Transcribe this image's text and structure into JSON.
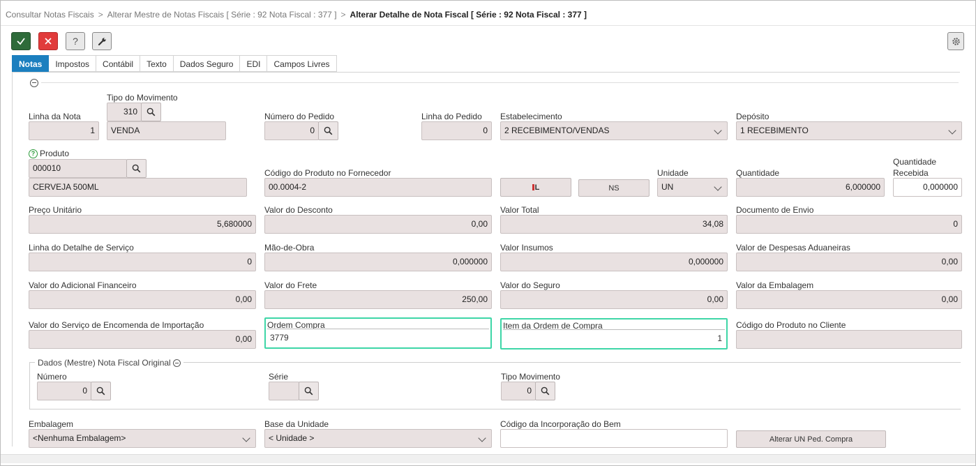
{
  "breadcrumb": {
    "item1": "Consultar Notas Fiscais",
    "item2": "Alterar Mestre de Notas Fiscais [ Série : 92 Nota Fiscal : 377 ]",
    "current": "Alterar Detalhe de Nota Fiscal [ Série : 92 Nota Fiscal : 377 ]",
    "separator": ">"
  },
  "toolbar": {
    "confirm_icon": "check-icon",
    "cancel_icon": "close-icon",
    "help_label": "?",
    "tools_icon": "wrench-icon",
    "settings_icon": "gear-icon"
  },
  "tabs": [
    "Notas",
    "Impostos",
    "Contábil",
    "Texto",
    "Dados Seguro",
    "EDI",
    "Campos Livres"
  ],
  "form": {
    "linha_nota": {
      "label": "Linha da Nota",
      "value": "1"
    },
    "tipo_movimento": {
      "label": "Tipo do Movimento",
      "code": "310",
      "desc": "VENDA"
    },
    "numero_pedido": {
      "label": "Número do Pedido",
      "value": "0"
    },
    "linha_pedido": {
      "label": "Linha do Pedido",
      "value": "0"
    },
    "estabelecimento": {
      "label": "Estabelecimento",
      "value": "2 RECEBIMENTO/VENDAS"
    },
    "deposito": {
      "label": "Depósito",
      "value": "1 RECEBIMENTO"
    },
    "produto": {
      "label": "Produto",
      "code": "000010",
      "desc": "CERVEJA 500ML"
    },
    "codigo_fornecedor": {
      "label": "Código do Produto no Fornecedor",
      "value": "00.0004-2"
    },
    "l_button": "L",
    "ns_button": "NS",
    "unidade": {
      "label": "Unidade",
      "value": "UN"
    },
    "quantidade": {
      "label": "Quantidade",
      "value": "6,000000"
    },
    "quantidade_recebida": {
      "label1": "Quantidade",
      "label2": "Recebida",
      "value": "0,000000"
    },
    "preco_unitario": {
      "label": "Preço Unitário",
      "value": "5,680000"
    },
    "valor_desconto": {
      "label": "Valor do Desconto",
      "value": "0,00"
    },
    "valor_total": {
      "label": "Valor Total",
      "value": "34,08"
    },
    "documento_envio": {
      "label": "Documento de Envio",
      "value": "0"
    },
    "linha_detalhe_servico": {
      "label": "Linha do Detalhe de Serviço",
      "value": "0"
    },
    "mao_obra": {
      "label": "Mão-de-Obra",
      "value": "0,000000"
    },
    "valor_insumos": {
      "label": "Valor Insumos",
      "value": "0,000000"
    },
    "despesas_aduaneiras": {
      "label": "Valor de Despesas Aduaneiras",
      "value": "0,00"
    },
    "adicional_financeiro": {
      "label": "Valor do Adicional Financeiro",
      "value": "0,00"
    },
    "valor_frete": {
      "label": "Valor do Frete",
      "value": "250,00"
    },
    "valor_seguro": {
      "label": "Valor do Seguro",
      "value": "0,00"
    },
    "valor_embalagem": {
      "label": "Valor da Embalagem",
      "value": "0,00"
    },
    "servico_encomenda": {
      "label": "Valor do Serviço de Encomenda de Importação",
      "value": "0,00"
    },
    "ordem_compra": {
      "label": "Ordem Compra",
      "value": "3779"
    },
    "item_ordem_compra": {
      "label": "Item da Ordem de Compra",
      "value": "1"
    },
    "codigo_cliente": {
      "label": "Código do Produto no Cliente",
      "value": ""
    }
  },
  "original": {
    "legend": "Dados (Mestre) Nota Fiscal Original",
    "numero": {
      "label": "Número",
      "value": "0"
    },
    "serie": {
      "label": "Série",
      "value": ""
    },
    "tipo_movimento": {
      "label": "Tipo Movimento",
      "value": "0"
    }
  },
  "bottom": {
    "embalagem": {
      "label": "Embalagem",
      "value": "<Nenhuma Embalagem>"
    },
    "base_unidade": {
      "label": "Base da Unidade",
      "value": "< Unidade >"
    },
    "incorporacao": {
      "label": "Código da Incorporação do Bem",
      "value": ""
    },
    "alterar_un_button": "Alterar UN Ped. Compra"
  },
  "colors": {
    "accent": "#1b7fbf",
    "confirm": "#2e6b3a",
    "cancel": "#e13b3b",
    "highlight": "#3ed6a7"
  }
}
